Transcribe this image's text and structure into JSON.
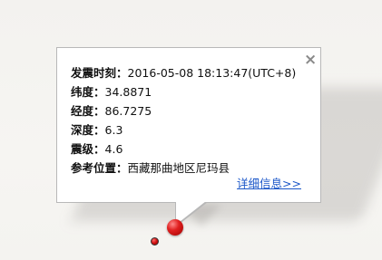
{
  "popup": {
    "close_label": "×",
    "fields": [
      {
        "label": "发震时刻：",
        "value": "2016-05-08 18:13:47(UTC+8)"
      },
      {
        "label": "纬度：",
        "value": "34.8871"
      },
      {
        "label": "经度：",
        "value": "86.7275"
      },
      {
        "label": "深度：",
        "value": "6.3"
      },
      {
        "label": "震级：",
        "value": "4.6"
      },
      {
        "label": "参考位置：",
        "value": "西藏那曲地区尼玛县"
      }
    ],
    "details_link": "详细信息>>"
  },
  "colors": {
    "link": "#1a56c8",
    "marker": "#e02020",
    "close_icon": "#8a8a8a"
  },
  "icons": {
    "close": "close-icon",
    "main_marker": "earthquake-marker-icon",
    "secondary_marker": "earthquake-marker-icon"
  }
}
